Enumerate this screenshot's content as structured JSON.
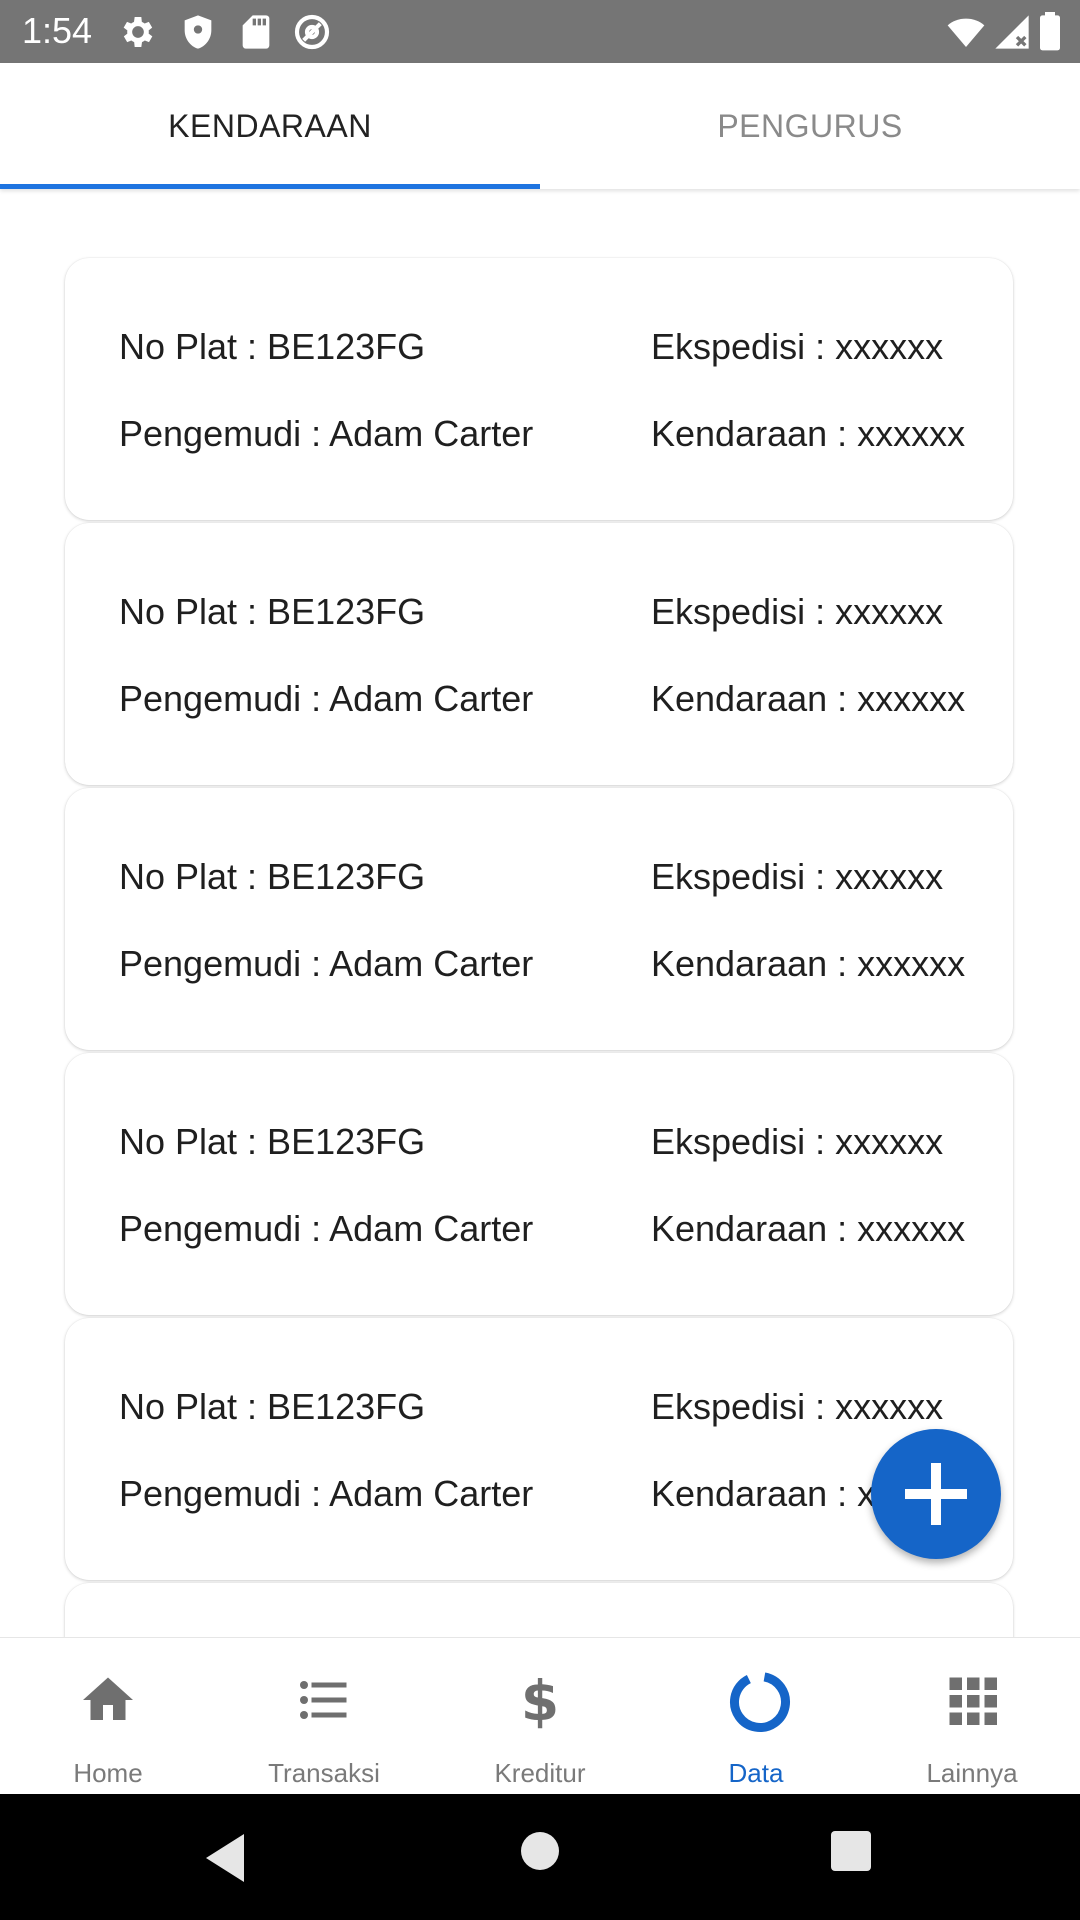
{
  "status_bar": {
    "time": "1:54",
    "left_icons": [
      "settings-icon",
      "shield-icon",
      "sd-card-icon",
      "at-sign-icon"
    ],
    "right_icons": [
      "wifi-icon",
      "signal-icon",
      "battery-icon"
    ]
  },
  "tabs": [
    {
      "label": "KENDARAAN",
      "active": true
    },
    {
      "label": "PENGURUS",
      "active": false
    }
  ],
  "vehicles": [
    {
      "plat": "No Plat : BE123FG",
      "ekspedisi": "Ekspedisi : xxxxxx",
      "pengemudi": "Pengemudi : Adam Carter",
      "kendaraan": "Kendaraan : xxxxxx"
    },
    {
      "plat": "No Plat : BE123FG",
      "ekspedisi": "Ekspedisi : xxxxxx",
      "pengemudi": "Pengemudi : Adam Carter",
      "kendaraan": "Kendaraan : xxxxxx"
    },
    {
      "plat": "No Plat : BE123FG",
      "ekspedisi": "Ekspedisi : xxxxxx",
      "pengemudi": "Pengemudi : Adam Carter",
      "kendaraan": "Kendaraan : xxxxxx"
    },
    {
      "plat": "No Plat : BE123FG",
      "ekspedisi": "Ekspedisi : xxxxxx",
      "pengemudi": "Pengemudi : Adam Carter",
      "kendaraan": "Kendaraan : xxxxxx"
    },
    {
      "plat": "No Plat : BE123FG",
      "ekspedisi": "Ekspedisi : xxxxxx",
      "pengemudi": "Pengemudi : Adam Carter",
      "kendaraan": "Kendaraan : xxxxxx"
    }
  ],
  "fab": {
    "icon": "plus-icon"
  },
  "bottom_nav": [
    {
      "label": "Home",
      "icon": "home-icon",
      "active": false
    },
    {
      "label": "Transaksi",
      "icon": "list-icon",
      "active": false
    },
    {
      "label": "Kreditur",
      "icon": "dollar-icon",
      "active": false
    },
    {
      "label": "Data",
      "icon": "donut-icon",
      "active": true
    },
    {
      "label": "Lainnya",
      "icon": "grid-icon",
      "active": false
    }
  ],
  "colors": {
    "accent": "#1e74e0",
    "fab": "#1565c8",
    "status_bar": "#757575",
    "inactive_text": "#7a7a7a"
  }
}
